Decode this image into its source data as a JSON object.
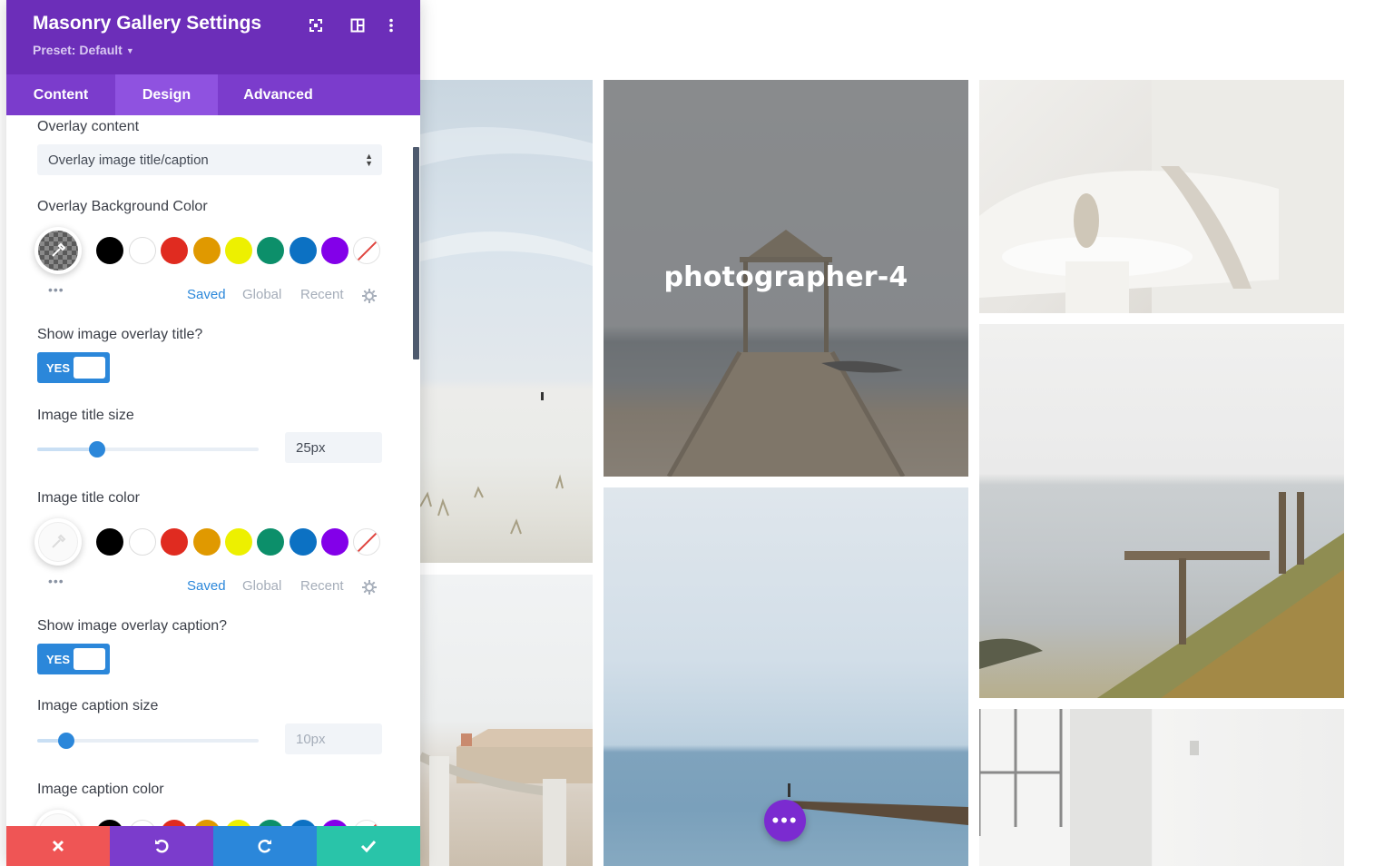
{
  "panel": {
    "title": "Masonry Gallery Settings",
    "preset": "Preset: Default",
    "tabs": [
      {
        "label": "Content"
      },
      {
        "label": "Design"
      },
      {
        "label": "Advanced"
      }
    ]
  },
  "fields": {
    "overlay_content": {
      "label": "Overlay content",
      "value": "Overlay image title/caption"
    },
    "overlay_bg": {
      "label": "Overlay Background Color"
    },
    "show_title": {
      "label": "Show image overlay title?",
      "value": "YES"
    },
    "title_size": {
      "label": "Image title size",
      "value": "25px",
      "slider_percent": 27
    },
    "title_color": {
      "label": "Image title color"
    },
    "show_caption": {
      "label": "Show image overlay caption?",
      "value": "YES"
    },
    "caption_size": {
      "label": "Image caption size",
      "value": "10px",
      "slider_percent": 13
    },
    "caption_color": {
      "label": "Image caption color"
    }
  },
  "palette": {
    "swatches": [
      "#000000",
      "#ffffff",
      "#e02b20",
      "#e09900",
      "#edf000",
      "#0c8f6a",
      "#0c71c3",
      "#8300e9"
    ],
    "tabs": [
      "Saved",
      "Global",
      "Recent"
    ],
    "active_tab": "Saved"
  },
  "gallery": {
    "hover_title": "photographer-4"
  },
  "footer": {
    "cancel_color": "#ef5555",
    "undo_color": "#7b3ccc",
    "redo_color": "#2b87da",
    "save_color": "#29c4a9"
  },
  "colors": {
    "header": "#6c2eb9",
    "tabs": "#7b3ccc",
    "accent": "#2b87da"
  }
}
